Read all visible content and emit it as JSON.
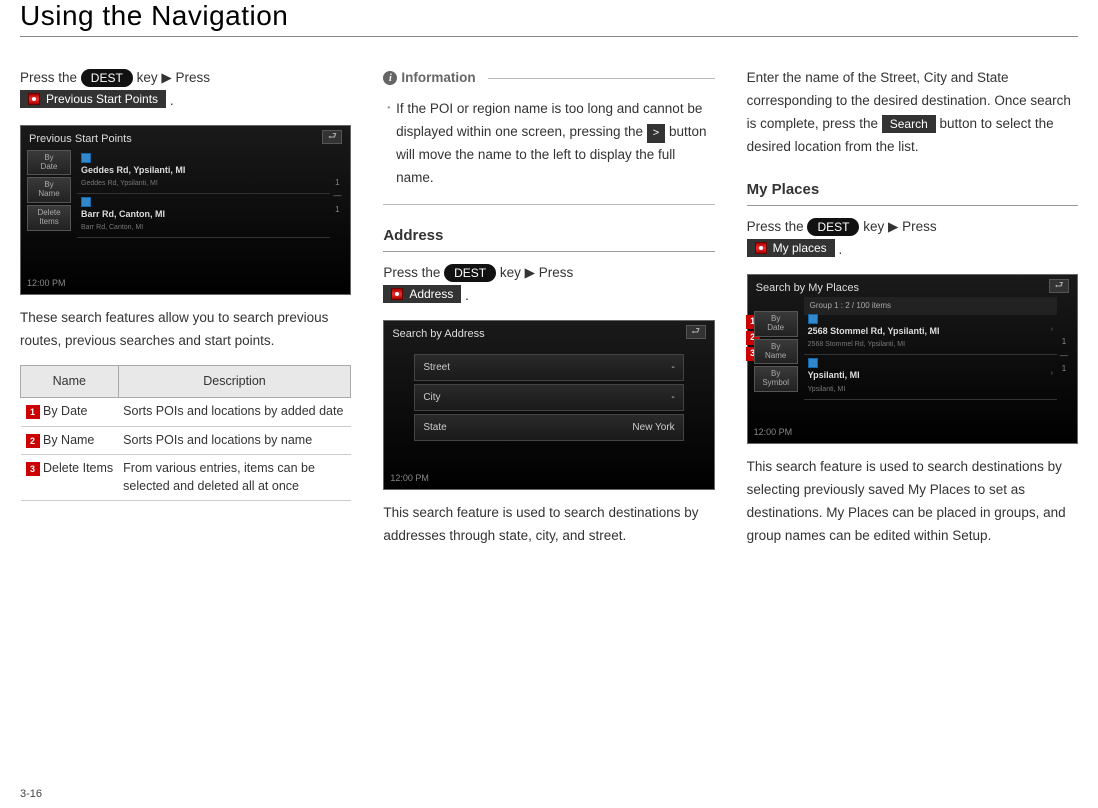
{
  "page": {
    "title": "Using the Navigation",
    "footer": "3-16"
  },
  "col1": {
    "press_the": "Press the ",
    "dest_key": "DEST",
    "key_press": " key ▶ Press",
    "prev_start_btn": "Previous Start Points",
    "desc": "These search features allow you to search previous routes, previous searches and start points.",
    "table": {
      "h1": "Name",
      "h2": "Description",
      "rows": [
        {
          "n": "1",
          "name": "By Date",
          "desc": "Sorts POIs and locations by added date"
        },
        {
          "n": "2",
          "name": "By Name",
          "desc": "Sorts POIs and locations by name"
        },
        {
          "n": "3",
          "name": "Delete Items",
          "desc": "From various entries, items can be selected and deleted all at once"
        }
      ]
    },
    "sc": {
      "title": "Previous Start Points",
      "back": "⮐",
      "side": [
        "By\nDate",
        "By\nName",
        "Delete\nItems"
      ],
      "rows": [
        {
          "main": "Geddes Rd, Ypsilanti, MI",
          "sub": "Geddes Rd, Ypsilanti, MI"
        },
        {
          "main": "Barr Rd, Canton, MI",
          "sub": "Barr Rd, Canton, MI"
        }
      ],
      "time": "12:00 PM",
      "pager": "1\n—\n1"
    }
  },
  "col2": {
    "info_label": "Information",
    "info_text": "If the POI or region name is too long and cannot be displayed within one screen, pressing the ",
    "gt": ">",
    "info_text2": " button will move the name to the left to display the full name.",
    "addr_head": "Address",
    "press_the": "Press the ",
    "dest_key": "DEST",
    "key_press": " key ▶ Press",
    "addr_btn": "Address",
    "desc": "This search feature is used to search destinations by addresses through state, city, and street.",
    "sc": {
      "title": "Search by Address",
      "back": "⮐",
      "fields": [
        {
          "label": "Street",
          "val": "-"
        },
        {
          "label": "City",
          "val": "-"
        },
        {
          "label": "State",
          "val": "New York"
        }
      ],
      "time": "12:00 PM"
    }
  },
  "col3": {
    "intro": "Enter the name of the Street, City and State corresponding to the desired destination. Once search is complete, press the ",
    "search_btn": "Search",
    "intro2": " button to select the desired location from the list.",
    "mp_head": "My Places",
    "press_the": "Press the ",
    "dest_key": "DEST",
    "key_press": " key ▶ Press",
    "mp_btn": "My places",
    "desc": "This search feature is used to search destinations by selecting previously saved My Places to set as destinations. My Places can be placed in groups, and group names can be edited within Setup.",
    "sc": {
      "title": "Search by My Places",
      "back": "⮐",
      "group": "Group 1 : 2 / 100 items",
      "side": [
        "By\nDate",
        "By\nName",
        "By\nSymbol"
      ],
      "rows": [
        {
          "main": "2568 Stommel Rd, Ypsilanti, MI",
          "sub": "2568 Stommel Rd, Ypsilanti, MI"
        },
        {
          "main": "Ypsilanti, MI",
          "sub": "Ypsilanti, MI"
        }
      ],
      "time": "12:00 PM",
      "pager": "1\n—\n1",
      "badges": [
        "1",
        "2",
        "3"
      ]
    }
  }
}
